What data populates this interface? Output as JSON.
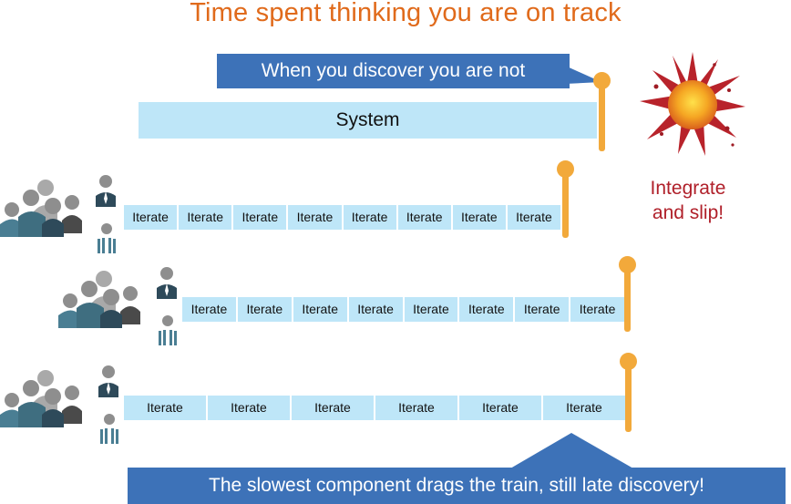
{
  "title": "Time spent thinking you are on track",
  "top_callout": "When you discover you are not",
  "system_bar": "System",
  "integrate_text": [
    "Integrate",
    "and slip!"
  ],
  "rows": [
    {
      "team": "team-1",
      "cells": [
        "Iterate",
        "Iterate",
        "Iterate",
        "Iterate",
        "Iterate",
        "Iterate",
        "Iterate",
        "Iterate"
      ]
    },
    {
      "team": "team-2",
      "cells": [
        "Iterate",
        "Iterate",
        "Iterate",
        "Iterate",
        "Iterate",
        "Iterate",
        "Iterate",
        "Iterate"
      ]
    },
    {
      "team": "team-3",
      "cells": [
        "Iterate",
        "Iterate",
        "Iterate",
        "Iterate",
        "Iterate",
        "Iterate"
      ]
    }
  ],
  "bottom_callout": "The slowest component drags the train, still late discovery!",
  "colors": {
    "title": "#E06A1B",
    "callout_blue": "#3D72B8",
    "bar_light_blue": "#BEE6F8",
    "pin_orange": "#F2A93B",
    "slip_red": "#B0202A"
  }
}
